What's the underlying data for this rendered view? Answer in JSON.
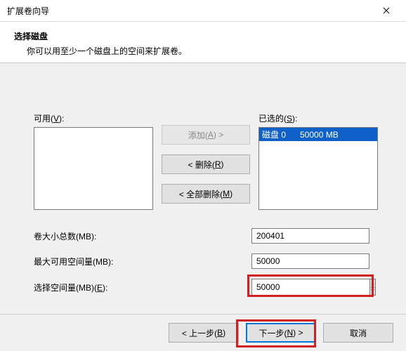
{
  "window": {
    "title": "扩展卷向导"
  },
  "header": {
    "main": "选择磁盘",
    "sub": "你可以用至少一个磁盘上的空间来扩展卷。"
  },
  "lists": {
    "available_label_pre": "可用(",
    "available_hotkey": "V",
    "available_label_post": "):",
    "selected_label_pre": "已选的(",
    "selected_hotkey": "S",
    "selected_label_post": "):",
    "selected_item": "磁盘 0      50000 MB"
  },
  "buttons": {
    "add_pre": "添加(",
    "add_hotkey": "A",
    "add_post": ") >",
    "remove_pre": "< 删除(",
    "remove_hotkey": "R",
    "remove_post": ")",
    "remove_all_pre": "< 全部删除(",
    "remove_all_hotkey": "M",
    "remove_all_post": ")"
  },
  "fields": {
    "total_label": "卷大小总数(MB):",
    "total_value": "200401",
    "max_label": "最大可用空间量(MB):",
    "max_value": "50000",
    "select_label_pre": "选择空间量(MB)(",
    "select_hotkey": "E",
    "select_label_post": "):",
    "select_value": "50000"
  },
  "footer": {
    "back_pre": "< 上一步(",
    "back_hotkey": "B",
    "back_post": ")",
    "next_pre": "下一步(",
    "next_hotkey": "N",
    "next_post": ") >",
    "cancel": "取消"
  }
}
